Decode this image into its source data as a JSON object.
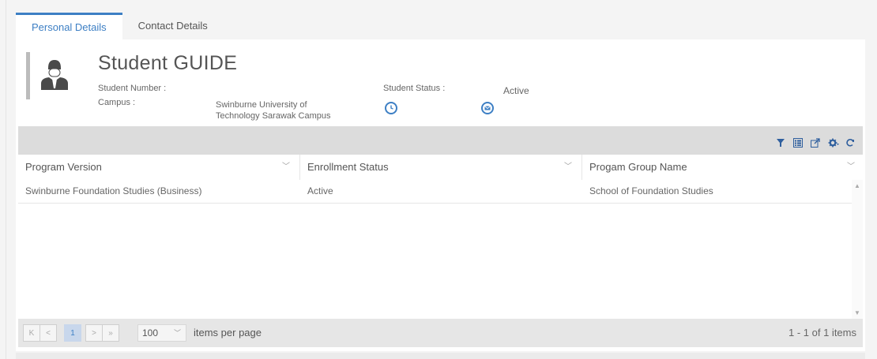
{
  "tabs": [
    {
      "label": "Personal Details",
      "active": true
    },
    {
      "label": "Contact Details",
      "active": false
    }
  ],
  "student": {
    "title": "Student GUIDE",
    "number_label": "Student Number :",
    "number_value": "",
    "campus_label": "Campus :",
    "campus_value_line1": "Swinburne University of",
    "campus_value_line2": "Technology Sarawak Campus",
    "status_label": "Student Status :",
    "status_value": "Active"
  },
  "toolbar": {
    "icons": [
      "filter-icon",
      "column-chooser-icon",
      "export-icon",
      "settings-icon",
      "refresh-icon"
    ]
  },
  "grid": {
    "columns": [
      "Program Version",
      "Enrollment Status",
      "Progam Group Name"
    ],
    "rows": [
      [
        "Swinburne Foundation Studies (Business)",
        "Active",
        "School of Foundation Studies"
      ]
    ]
  },
  "pager": {
    "first": "K",
    "prev": "<",
    "current_page": "1",
    "next": ">",
    "last": "»",
    "page_size": "100",
    "items_per_page_label": "items per page",
    "count_text": "1 - 1 of 1 items"
  },
  "colors": {
    "accent": "#3d7fc4",
    "toolbar_bg": "#dcdcdc",
    "pager_bg": "#e6e6e6"
  }
}
